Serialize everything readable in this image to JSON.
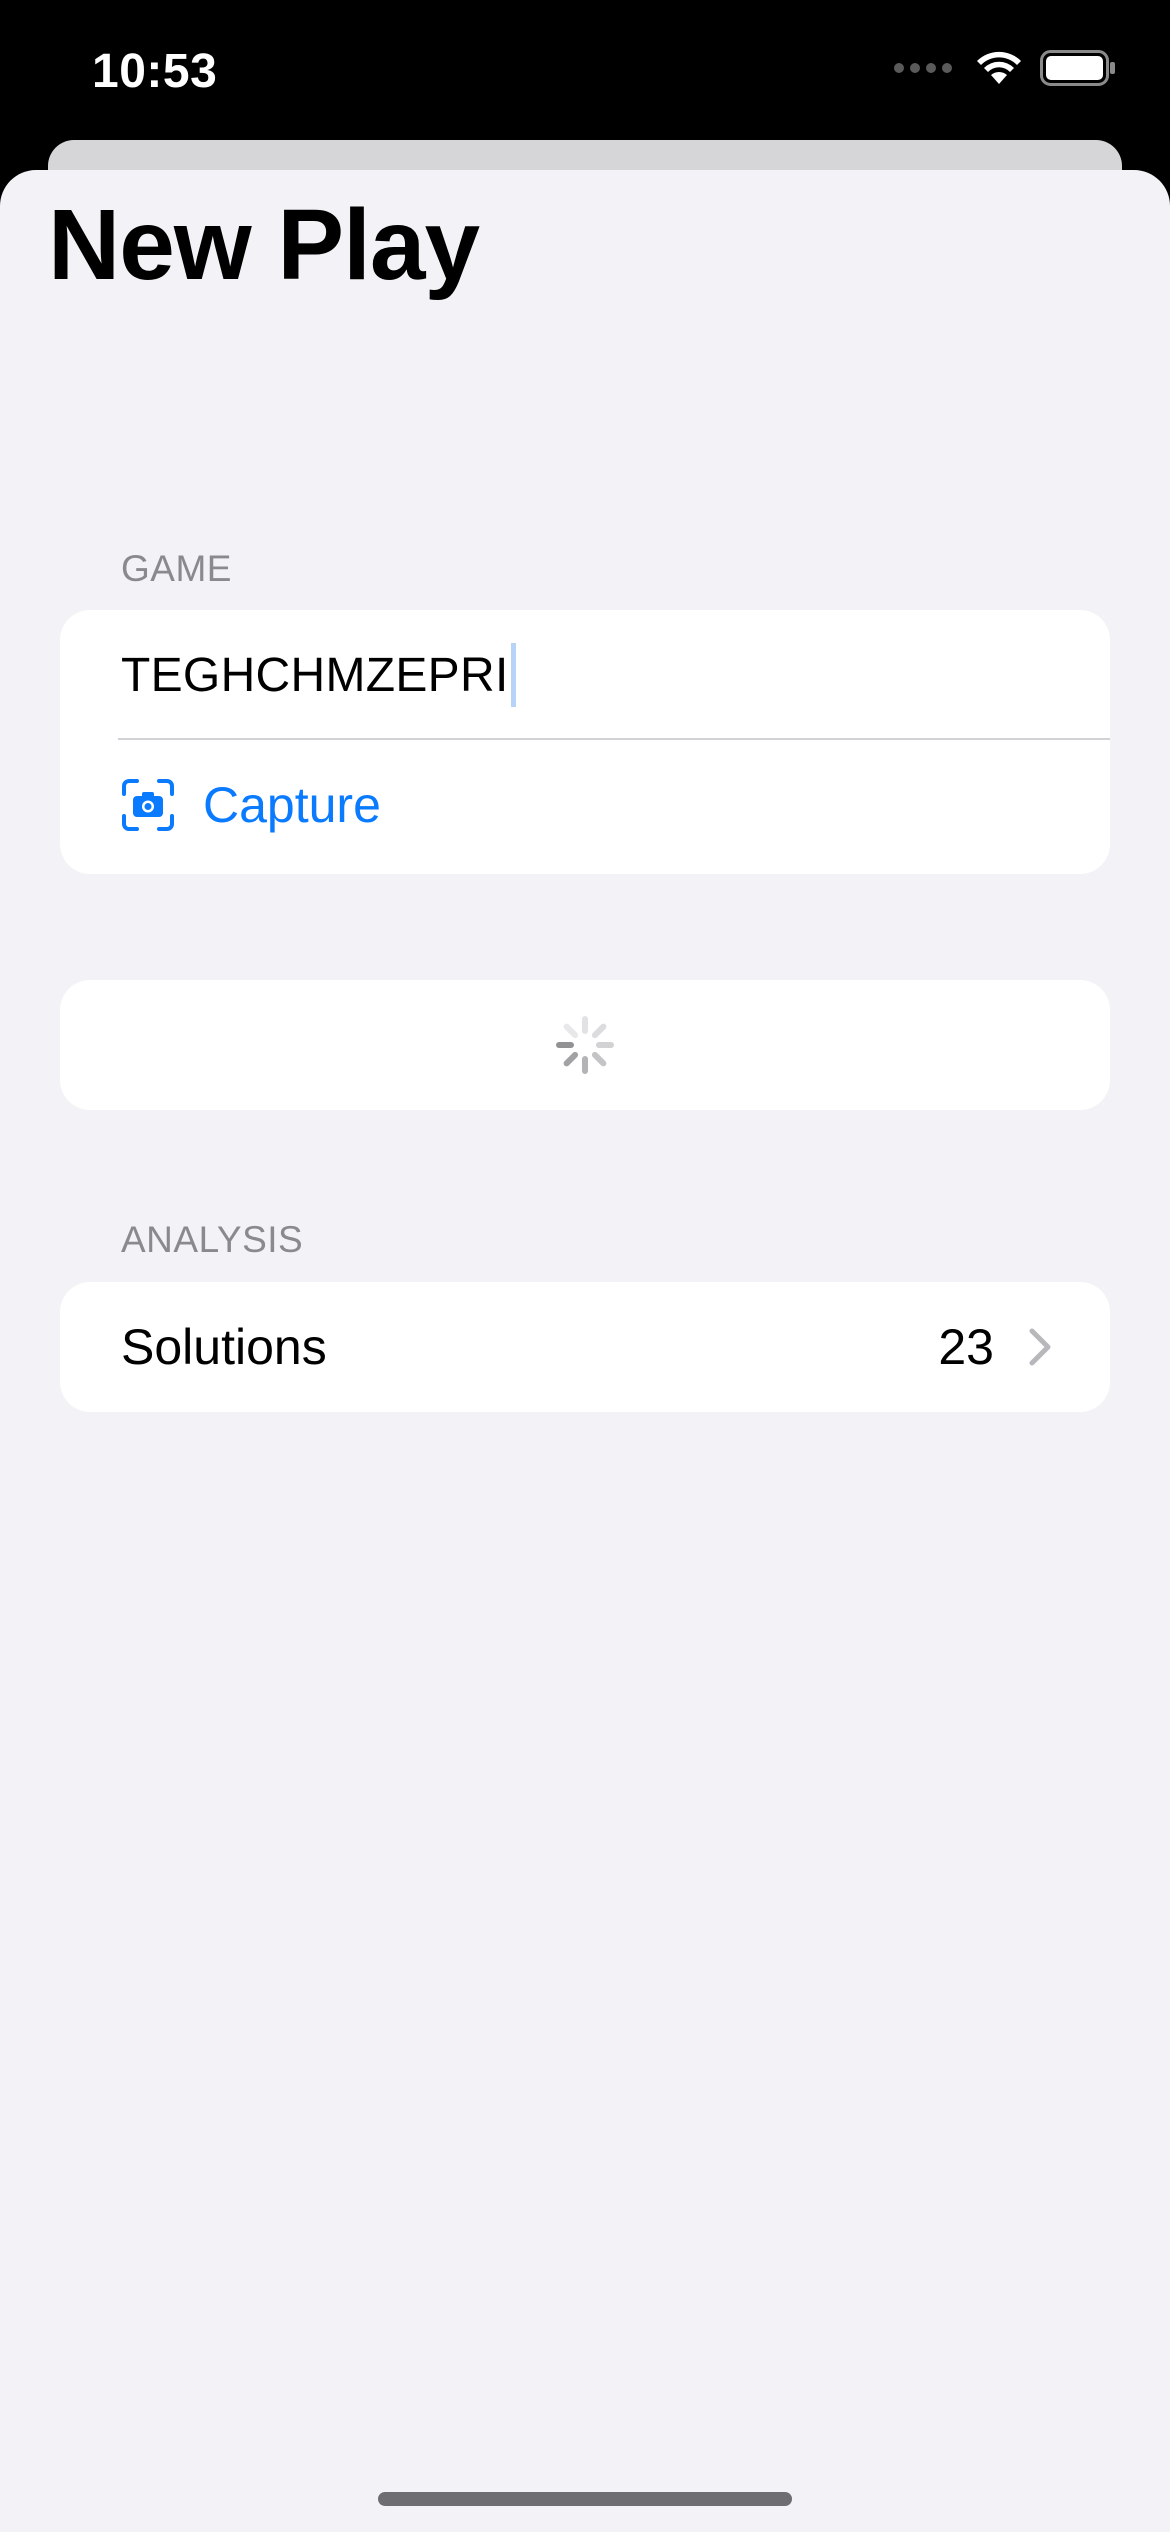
{
  "status_bar": {
    "time": "10:53",
    "icons": [
      "signal-icon",
      "wifi-icon",
      "battery-icon"
    ]
  },
  "page": {
    "title": "New Play"
  },
  "game_section": {
    "header": "GAME",
    "input_value": "TEGHCHMZEPRI",
    "capture_icon": "camera-viewfinder-icon",
    "capture_label": "Capture"
  },
  "loading": {
    "icon": "activity-spinner-icon"
  },
  "analysis_section": {
    "header": "ANALYSIS",
    "solutions_label": "Solutions",
    "solutions_value": "23",
    "chevron_icon": "chevron-right-icon"
  },
  "colors": {
    "accent": "#0a7aff",
    "background": "#f2f2f7",
    "card": "#ffffff",
    "secondary_text": "#8a8a8e"
  }
}
